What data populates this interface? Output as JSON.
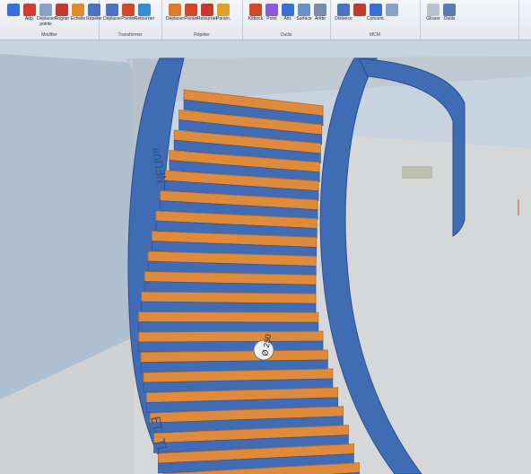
{
  "ribbon": {
    "groups": [
      {
        "caption": "Modifier",
        "tools": [
          {
            "label": "",
            "icon": "rotate-icon",
            "color": "#3a6fd8"
          },
          {
            "label": "Adp.",
            "icon": "adapt-icon",
            "color": "#d83a2e"
          },
          {
            "label": "Déplacer\npoints",
            "icon": "move-points-icon",
            "color": "#8aa0c4"
          },
          {
            "label": "Rogner",
            "icon": "trim-icon",
            "color": "#c63b30"
          },
          {
            "label": "Echelle",
            "icon": "scale-icon",
            "color": "#e08a2a"
          },
          {
            "label": "Répéter",
            "icon": "repeat-icon",
            "color": "#4a73c4"
          }
        ]
      },
      {
        "caption": "Transformer",
        "tools": [
          {
            "label": "Déplacer",
            "icon": "transform-move-icon",
            "color": "#4a73c4"
          },
          {
            "label": "Pivoter",
            "icon": "transform-rotate-icon",
            "color": "#d04a2a"
          },
          {
            "label": "Retourner",
            "icon": "transform-flip-icon",
            "color": "#3a8ad8"
          }
        ]
      },
      {
        "caption": "Répéter",
        "tools": [
          {
            "label": "Déplacer",
            "icon": "repeat-move-icon",
            "color": "#e07a2a"
          },
          {
            "label": "Pivoter",
            "icon": "repeat-rotate-icon",
            "color": "#d04a2a"
          },
          {
            "label": "Retourner",
            "icon": "repeat-flip-icon",
            "color": "#c63b30"
          },
          {
            "label": "Param.",
            "icon": "parameters-icon",
            "color": "#e0a02a"
          }
        ]
      },
      {
        "caption": "Outils",
        "tools": [
          {
            "label": "Kitbock",
            "icon": "kitbock-icon",
            "color": "#d04a2a"
          },
          {
            "label": "Point",
            "icon": "point-icon",
            "color": "#8a5ad8"
          },
          {
            "label": "Attr.",
            "icon": "attributes-icon",
            "color": "#3a6fd8"
          },
          {
            "label": "Surface",
            "icon": "surface-icon",
            "color": "#6a90c8"
          },
          {
            "label": "Arête",
            "icon": "edge-icon",
            "color": "#7a8ca8"
          }
        ]
      },
      {
        "caption": "MCM",
        "tools": [
          {
            "label": "Distance",
            "icon": "distance-icon",
            "color": "#4a73c4"
          },
          {
            "label": "",
            "icon": "grid-icon",
            "color": "#c63b30"
          },
          {
            "label": "Concent.",
            "icon": "concentric-icon",
            "color": "#3a6fd8"
          },
          {
            "label": "",
            "icon": "mcm-small-icon",
            "color": "#8aa0c4"
          }
        ]
      },
      {
        "caption": "",
        "tools": [
          {
            "label": "Glisser",
            "icon": "drag-icon",
            "color": "#b8c2d0"
          },
          {
            "label": "Outils",
            "icon": "tools-icon",
            "color": "#5a7ab8"
          }
        ]
      }
    ]
  },
  "viewport": {
    "colors": {
      "steel": "#3f6cb5",
      "steel_dark": "#2b4f8e",
      "tread": "#e08a3c",
      "tread_edge": "#b86a24",
      "floor": "#d8d9d9",
      "wall": "#bfcbd6"
    },
    "dimension_label": "Ø 250",
    "steps": 20
  }
}
